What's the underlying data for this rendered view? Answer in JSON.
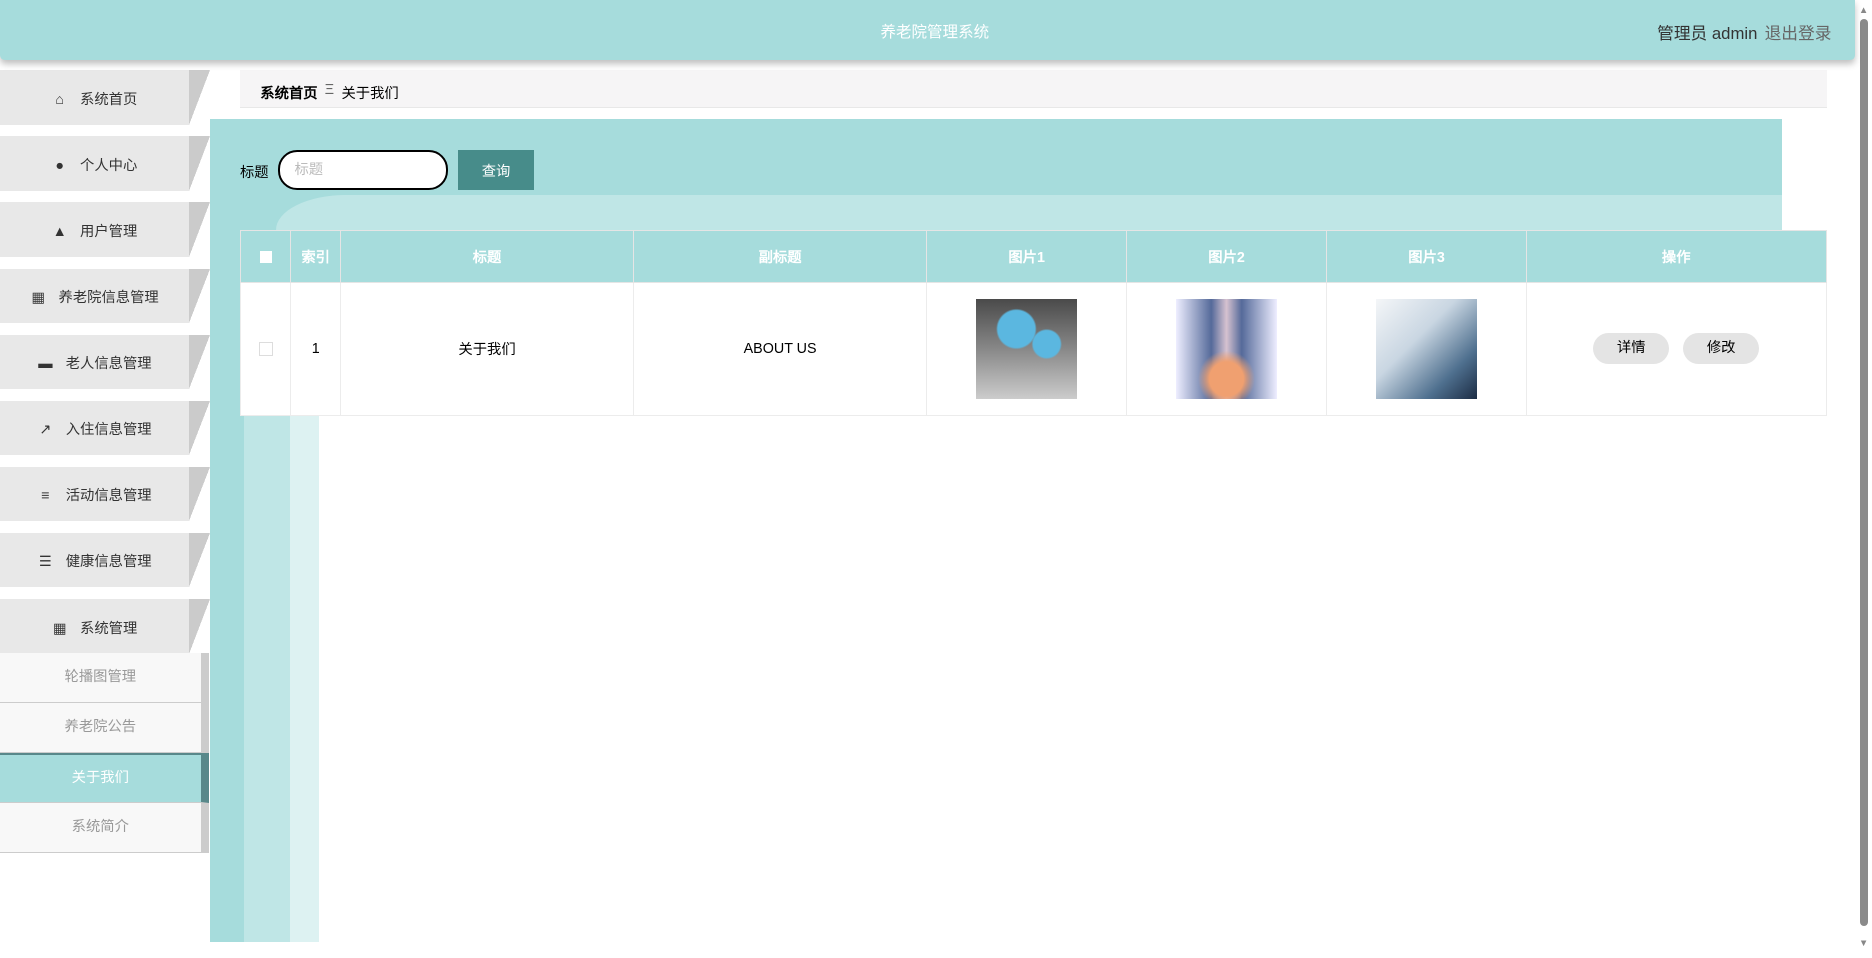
{
  "header": {
    "title": "养老院管理系统",
    "user": "管理员 admin",
    "logout": "退出登录"
  },
  "sidebar": {
    "items": [
      {
        "label": "系统首页",
        "icon": "home-icon",
        "glyph": "⌂"
      },
      {
        "label": "个人中心",
        "icon": "person-icon",
        "glyph": "●"
      },
      {
        "label": "用户管理",
        "icon": "user-icon",
        "glyph": "▲"
      },
      {
        "label": "养老院信息管理",
        "icon": "grid-icon",
        "glyph": "▦"
      },
      {
        "label": "老人信息管理",
        "icon": "inbox-icon",
        "glyph": "▬"
      },
      {
        "label": "入住信息管理",
        "icon": "chart-icon",
        "glyph": "↗"
      },
      {
        "label": "活动信息管理",
        "icon": "list-icon",
        "glyph": "≡"
      },
      {
        "label": "健康信息管理",
        "icon": "indent-icon",
        "glyph": "☰"
      },
      {
        "label": "系统管理",
        "icon": "grid-icon",
        "glyph": "▦"
      }
    ],
    "submenu": [
      "轮播图管理",
      "养老院公告",
      "关于我们",
      "系统简介"
    ]
  },
  "breadcrumb": {
    "home": "系统首页",
    "sep": "Ξ",
    "current": "关于我们"
  },
  "search": {
    "label": "标题",
    "placeholder": "标题",
    "button": "查询"
  },
  "table": {
    "headers": [
      "索引",
      "标题",
      "副标题",
      "图片1",
      "图片2",
      "图片3",
      "操作"
    ],
    "rows": [
      {
        "index": "1",
        "title": "关于我们",
        "subtitle": "ABOUT US",
        "detail": "详情",
        "edit": "修改"
      }
    ]
  },
  "colors": {
    "accent": "#a6dcdc",
    "button": "#478c8a"
  }
}
